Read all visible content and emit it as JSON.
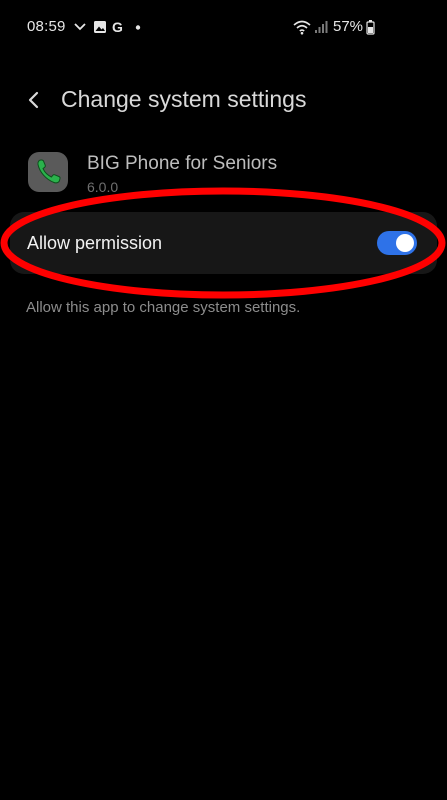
{
  "status_bar": {
    "time": "08:59",
    "battery_percent": "57%",
    "icons": [
      "chevron-down-icon",
      "gallery-icon",
      "google-icon",
      "dot-icon",
      "wifi-icon",
      "signal-icon",
      "battery-icon"
    ]
  },
  "header": {
    "title": "Change system settings",
    "back_icon": "back-arrow-icon"
  },
  "app": {
    "name": "BIG Phone for Seniors",
    "version": "6.0.0",
    "icon": "phone-icon",
    "icon_color": "#2bb24c"
  },
  "permission": {
    "label": "Allow permission",
    "enabled": true,
    "description": "Allow this app to change system settings."
  },
  "colors": {
    "background": "#000000",
    "toggle_on": "#2e72e8",
    "annotation": "#ff0000"
  }
}
